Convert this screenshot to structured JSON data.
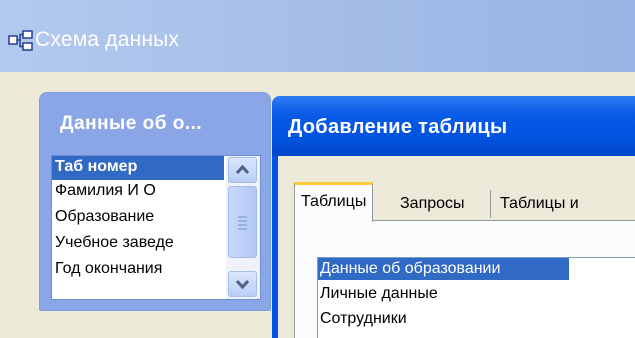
{
  "main_window": {
    "title": "Схема данных",
    "icon": "relationships-icon"
  },
  "table_window": {
    "title": "Данные об о...",
    "fields": [
      {
        "label": "Таб номер",
        "selected": true
      },
      {
        "label": "Фамилия И О",
        "selected": false
      },
      {
        "label": "Образование",
        "selected": false
      },
      {
        "label": "Учебное заведе",
        "selected": false
      },
      {
        "label": "Год окончания",
        "selected": false
      }
    ],
    "scroll_icons": [
      "scroll-up-icon",
      "scroll-thumb-grip-icon",
      "scroll-down-icon"
    ]
  },
  "add_table_dialog": {
    "title": "Добавление таблицы",
    "tabs": [
      {
        "label": "Таблицы",
        "active": true
      },
      {
        "label": "Запросы",
        "active": false
      },
      {
        "label": "Таблицы и",
        "active": false
      }
    ],
    "list_items": [
      {
        "label": "Данные об образовании",
        "selected": true
      },
      {
        "label": "Личные данные",
        "selected": false
      },
      {
        "label": "Сотрудники",
        "selected": false
      }
    ]
  },
  "colors": {
    "selection": "#316ac5",
    "dialog_titlebar": "#0054e3",
    "table_window": "#8aa6e6",
    "face": "#ece9d8"
  }
}
